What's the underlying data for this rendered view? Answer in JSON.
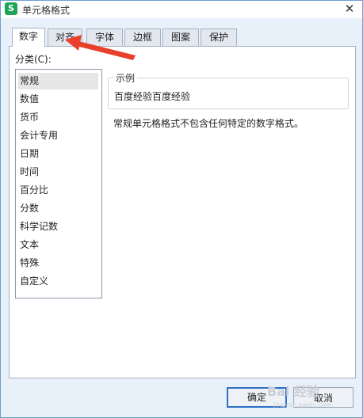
{
  "window": {
    "title": "单元格格式",
    "app_icon": "S"
  },
  "tabs": [
    {
      "label": "数字",
      "active": true
    },
    {
      "label": "对齐",
      "active": false
    },
    {
      "label": "字体",
      "active": false
    },
    {
      "label": "边框",
      "active": false
    },
    {
      "label": "图案",
      "active": false
    },
    {
      "label": "保护",
      "active": false
    }
  ],
  "category": {
    "label": "分类(C):",
    "items": [
      "常规",
      "数值",
      "货币",
      "会计专用",
      "日期",
      "时间",
      "百分比",
      "分数",
      "科学记数",
      "文本",
      "特殊",
      "自定义"
    ],
    "selected": "常规"
  },
  "sample": {
    "legend": "示例",
    "value": "百度经验百度经验"
  },
  "description": "常规单元格格式不包含任何特定的数字格式。",
  "buttons": {
    "ok": "确定",
    "cancel": "取消"
  },
  "annotation": {
    "arrow_color": "#e8402b"
  },
  "watermark": {
    "text": "Bai 经验",
    "sub": "jingyan.baidu.com"
  }
}
